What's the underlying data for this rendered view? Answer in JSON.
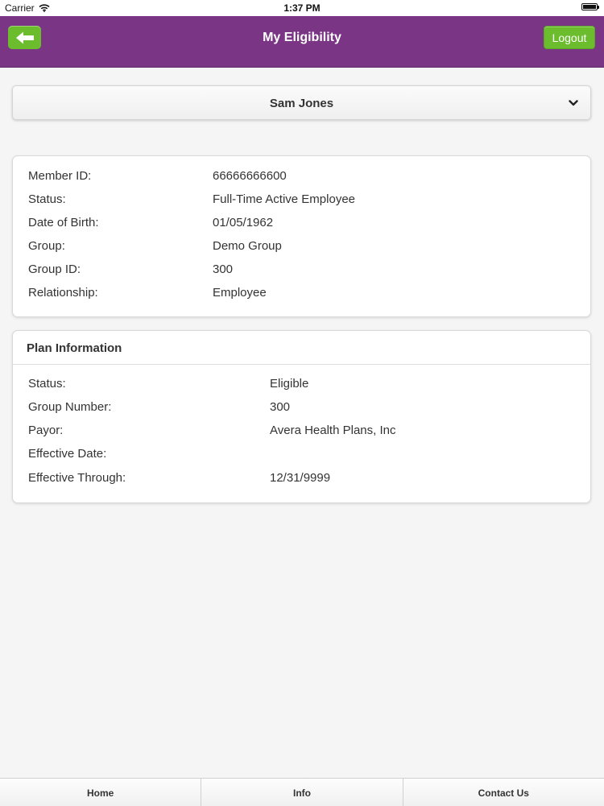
{
  "status_bar": {
    "carrier": "Carrier",
    "time": "1:37 PM"
  },
  "header": {
    "title": "My Eligibility",
    "logout_label": "Logout"
  },
  "member_select": {
    "selected": "Sam Jones"
  },
  "member_info": {
    "rows": [
      {
        "label": "Member ID:",
        "value": "66666666600"
      },
      {
        "label": "Status:",
        "value": "Full-Time Active Employee"
      },
      {
        "label": "Date of Birth:",
        "value": "01/05/1962"
      },
      {
        "label": "Group:",
        "value": "Demo Group"
      },
      {
        "label": "Group ID:",
        "value": "300"
      },
      {
        "label": "Relationship:",
        "value": "Employee"
      }
    ]
  },
  "plan_info": {
    "title": "Plan Information",
    "rows": [
      {
        "label": "Status:",
        "value": "Eligible"
      },
      {
        "label": "Group Number:",
        "value": "300"
      },
      {
        "label": "Payor:",
        "value": "Avera Health Plans, Inc"
      },
      {
        "label": "Effective Date:",
        "value": ""
      },
      {
        "label": "Effective Through:",
        "value": "12/31/9999"
      }
    ]
  },
  "tabs": [
    {
      "label": "Home"
    },
    {
      "label": "Info"
    },
    {
      "label": "Contact Us"
    }
  ],
  "colors": {
    "header_bg": "#7b3585",
    "accent_green": "#6bbd2e"
  },
  "icons": {
    "back": "back-arrow-icon",
    "wifi": "wifi-icon",
    "battery": "battery-icon",
    "select": "chevron-down-icon"
  }
}
